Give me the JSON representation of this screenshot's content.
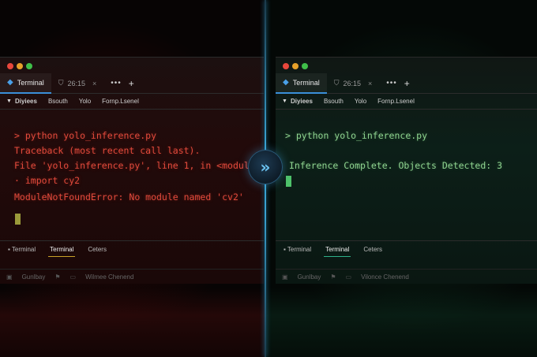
{
  "left_panel": {
    "tabs": [
      {
        "label": "Terminal",
        "icon": "terminal-icon"
      },
      {
        "label": "26:15",
        "icon": "shield-icon"
      }
    ],
    "menu": [
      "Diyiees",
      "Bsouth",
      "Yolo",
      "Fornp.Lsenel"
    ],
    "lines": [
      "> python yolo_inference.py",
      "Traceback (most recent call last).",
      "  File 'yolo_inference.py', line 1, in <module>",
      "  · import cy2",
      "ModuleNotFoundError: No module named 'cv2'"
    ],
    "bottom_tabs": [
      "Terminal",
      "Terminal",
      "Ceters"
    ],
    "status": [
      "Gunlbay",
      "Wilmee Chenend"
    ],
    "accent": "#e24a3c"
  },
  "right_panel": {
    "tabs": [
      {
        "label": "Terminal",
        "icon": "terminal-icon"
      },
      {
        "label": "26:15",
        "icon": "shield-icon"
      }
    ],
    "menu": [
      "Diyiees",
      "Bsouth",
      "Yolo",
      "Fornp.Lsenel"
    ],
    "lines": [
      "> python yolo_inference.py",
      "Inference Complete. Objects Detected: 3"
    ],
    "bottom_tabs": [
      "Terminal",
      "Terminal",
      "Ceters"
    ],
    "status": [
      "Gunlbay",
      "Vilonce Chenend"
    ],
    "accent": "#8fd490"
  },
  "center_button": {
    "icon": "fast-forward-icon",
    "glyph": "»",
    "color": "#6cc4f2"
  }
}
